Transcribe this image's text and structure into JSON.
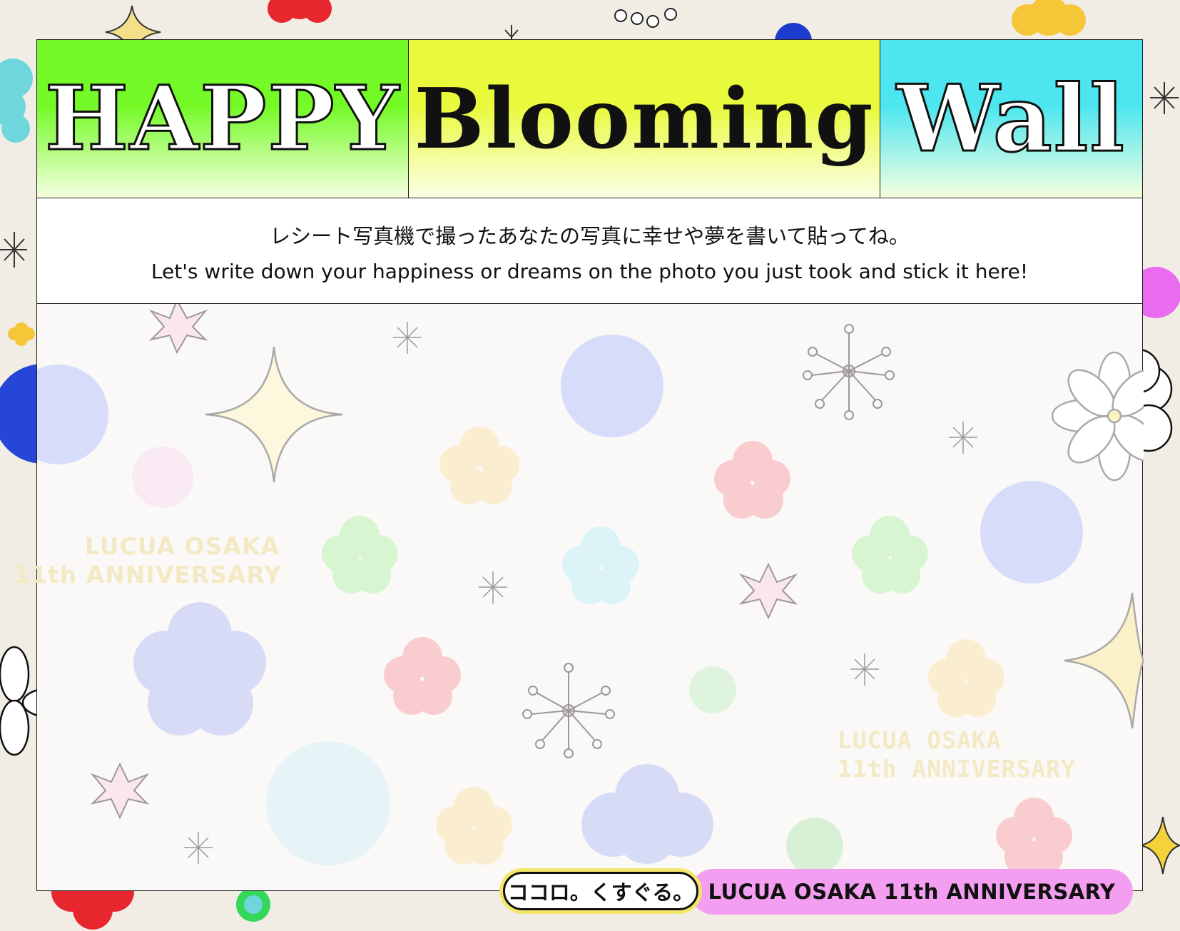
{
  "title": {
    "word1": "HAPPY",
    "word2": "Blooming",
    "word3": "Wall"
  },
  "instructions": {
    "ja": "レシート写真機で撮ったあなたの写真に幸せや夢を書いて貼ってね。",
    "en": "Let's write down your happiness or dreams on the photo you just took and stick it here!"
  },
  "watermarks": {
    "left_line1": "LUCUA OSAKA",
    "left_line2": "11th ANNIVERSARY",
    "right_line1": "LUCUA OSAKA",
    "right_line2": "11th ANNIVERSARY"
  },
  "footer": {
    "tagline_ja": "ココロ。くすぐる。",
    "anniversary": "LUCUA OSAKA  11th ANNIVERSARY"
  },
  "colors": {
    "green": "#74fa26",
    "yellow": "#e9fa3c",
    "cyan": "#4de6f0",
    "pink_badge": "#f39ef0",
    "background": "#f1ede5"
  }
}
